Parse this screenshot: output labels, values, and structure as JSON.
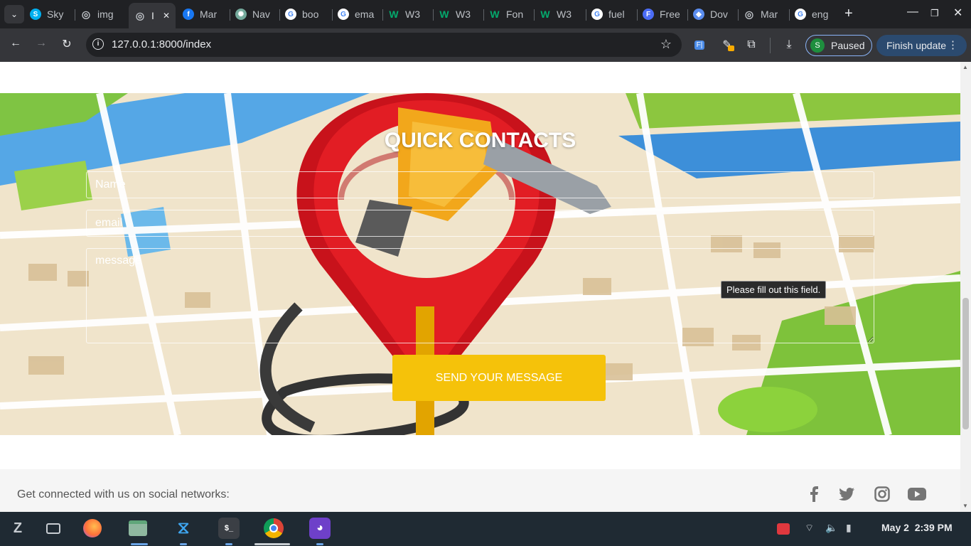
{
  "browser": {
    "tabs": [
      {
        "label": "Sky",
        "icon": "skype-icon",
        "color": "#00aff0",
        "glyph": "S"
      },
      {
        "label": "img",
        "icon": "globe-icon",
        "color": "#9aa0a6",
        "glyph": "◎"
      },
      {
        "label": "I",
        "icon": "globe-icon",
        "color": "#9aa0a6",
        "glyph": "◎",
        "active": true
      },
      {
        "label": "Mar",
        "icon": "facebook-icon",
        "color": "#1877f2",
        "glyph": "f"
      },
      {
        "label": "Nav",
        "icon": "openai-icon",
        "color": "#74aa9c",
        "glyph": "✺"
      },
      {
        "label": "boo",
        "icon": "google-icon",
        "color": "#ffffff",
        "glyph": "G"
      },
      {
        "label": "ema",
        "icon": "google-icon",
        "color": "#ffffff",
        "glyph": "G"
      },
      {
        "label": "W3",
        "icon": "w3schools-icon",
        "color": "#04aa6d",
        "glyph": "W"
      },
      {
        "label": "W3",
        "icon": "w3schools-icon",
        "color": "#04aa6d",
        "glyph": "W"
      },
      {
        "label": "Fon",
        "icon": "w3schools-icon",
        "color": "#04aa6d",
        "glyph": "W"
      },
      {
        "label": "W3",
        "icon": "w3schools-icon",
        "color": "#04aa6d",
        "glyph": "W"
      },
      {
        "label": "fuel",
        "icon": "google-icon",
        "color": "#ffffff",
        "glyph": "G"
      },
      {
        "label": "Free",
        "icon": "formspree-icon",
        "color": "#4b6cf6",
        "glyph": "F"
      },
      {
        "label": "Dov",
        "icon": "diamond-icon",
        "color": "#5b8def",
        "glyph": "◆"
      },
      {
        "label": "Mar",
        "icon": "globe-icon",
        "color": "#9aa0a6",
        "glyph": "◎"
      },
      {
        "label": "eng",
        "icon": "google-icon",
        "color": "#ffffff",
        "glyph": "G"
      }
    ],
    "url": "127.0.0.1:8000/index",
    "paused_label": "Paused",
    "profile_initial": "S",
    "finish_update_label": "Finish update"
  },
  "contact": {
    "title": "QUICK CONTACTS",
    "name_placeholder": "Name",
    "email_placeholder": "email",
    "message_placeholder": "message",
    "validation_tooltip": "Please fill out this field.",
    "send_label": "SEND YOUR MESSAGE"
  },
  "footer": {
    "text": "Get connected with us on social networks:",
    "social": [
      "facebook-icon",
      "twitter-icon",
      "instagram-icon",
      "youtube-icon"
    ]
  },
  "taskbar": {
    "date": "May 2",
    "time": "2:39 PM"
  },
  "colors": {
    "accent_button": "#f5c20a",
    "chrome_bg": "#202124",
    "toolbar_bg": "#35363a",
    "taskbar_bg": "#1f2a33"
  }
}
